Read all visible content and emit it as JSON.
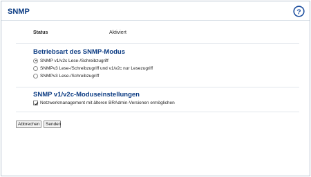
{
  "header": {
    "title": "SNMP",
    "help_icon": "help-question-icon",
    "accent_color": "#0a3a82"
  },
  "status": {
    "label": "Status",
    "value": "Aktiviert"
  },
  "mode_section": {
    "heading": "Betriebsart des SNMP-Modus",
    "options": [
      {
        "label": "SNMP v1/v2c Lese-/Schreibzugriff",
        "selected": true
      },
      {
        "label": "SNMPv3 Lese-/Schreibzugriff und v1/v2c nur Lesezugriff",
        "selected": false
      },
      {
        "label": "SNMPv3 Lese-/Schreibzugriff",
        "selected": false
      }
    ]
  },
  "v1v2c_section": {
    "heading": "SNMP v1/v2c-Moduseinstellungen",
    "checkbox_label": "Netzwerkmanagement mit älteren BRAdmin-Versionen ermöglichen",
    "checkbox_checked": true
  },
  "buttons": {
    "cancel_label": "Abbrechen",
    "submit_label": "Senden"
  }
}
